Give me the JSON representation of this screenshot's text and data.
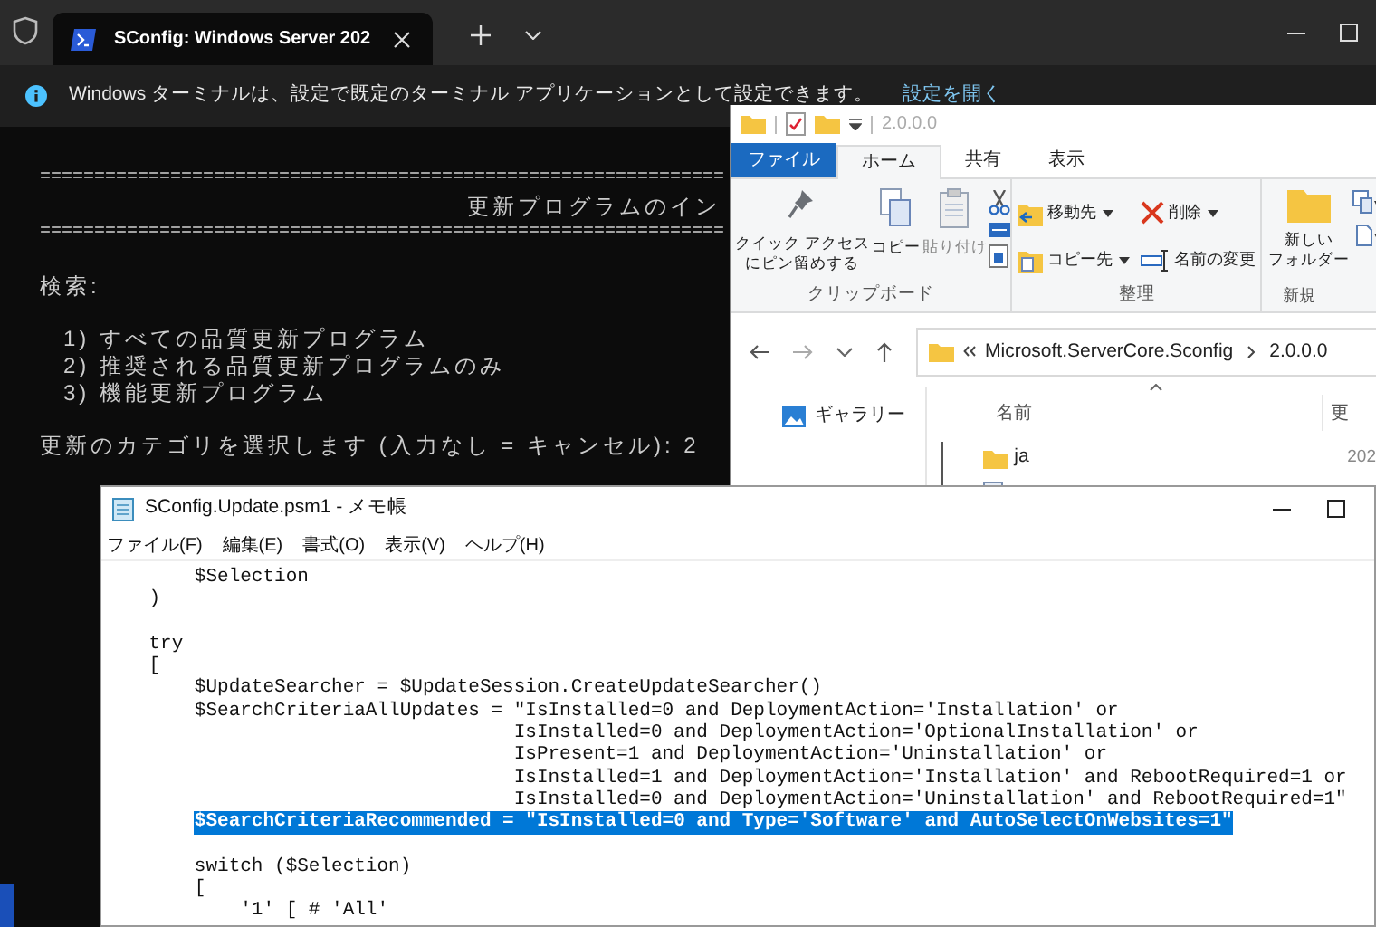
{
  "terminal": {
    "tabs": [
      {
        "title": "SConfig: Windows Server 202",
        "selected": true
      }
    ],
    "notification": {
      "text": "Windows ターミナルは、設定で既定のターミナル アプリケーションとして設定できます。",
      "link": "設定を開く"
    },
    "lines": [
      {
        "kind": "rule",
        "text": "==============================================================="
      },
      {
        "kind": "heading",
        "text": "更新プログラムのイン"
      },
      {
        "kind": "rule",
        "text": "==============================================================="
      },
      {
        "kind": "blank"
      },
      {
        "kind": "text",
        "text": "検索:"
      },
      {
        "kind": "blank"
      },
      {
        "kind": "item",
        "text": "1) すべての品質更新プログラム"
      },
      {
        "kind": "item",
        "text": "2) 推奨される品質更新プログラムのみ"
      },
      {
        "kind": "item",
        "text": "3) 機能更新プログラム"
      },
      {
        "kind": "blank"
      },
      {
        "kind": "text",
        "text": "更新のカテゴリを選択します (入力なし = キャンセル): 2"
      }
    ]
  },
  "explorer": {
    "title": "2.0.0.0",
    "ribbon_tabs": [
      {
        "label": "ファイル",
        "kind": "file",
        "selected": false
      },
      {
        "label": "ホーム",
        "kind": "tab",
        "selected": true
      },
      {
        "label": "共有",
        "kind": "tab",
        "selected": false
      },
      {
        "label": "表示",
        "kind": "tab",
        "selected": false
      }
    ],
    "clipboard": {
      "label": "クリップボード",
      "buttons": [
        {
          "lines": [
            "クイック アクセス",
            "にピン留めする"
          ],
          "kind": "pin",
          "disabled": false
        },
        {
          "lines": [
            "コピー"
          ],
          "kind": "copy",
          "disabled": false
        },
        {
          "lines": [
            "貼り付け"
          ],
          "kind": "paste",
          "disabled": true
        }
      ]
    },
    "organize": {
      "label": "整理",
      "buttons": [
        {
          "label": "移動先",
          "kind": "move",
          "menu": true
        },
        {
          "label": "コピー先",
          "kind": "copyto",
          "menu": true
        },
        {
          "label": "削除",
          "kind": "delete",
          "menu": true
        },
        {
          "label": "名前の変更",
          "kind": "rename",
          "menu": false
        }
      ]
    },
    "new": {
      "label": "新規",
      "button": [
        "新しい",
        "フォルダー"
      ]
    },
    "path": [
      "Microsoft.ServerCore.Sconfig",
      "2.0.0.0"
    ],
    "nav_items": [
      {
        "label": "ギャラリー"
      }
    ],
    "columns": [
      "名前",
      "更"
    ],
    "rows": [
      {
        "name": "ja",
        "column_2": "202"
      }
    ]
  },
  "notepad": {
    "title": "SConfig.Update.psm1 - メモ帳",
    "menu": [
      "ファイル(F)",
      "編集(E)",
      "書式(O)",
      "表示(V)",
      "ヘルプ(H)"
    ],
    "lines": [
      {
        "text": "        $Selection",
        "selected": false
      },
      {
        "text": "    )",
        "selected": false
      },
      {
        "selected": false
      },
      {
        "text": "    try",
        "selected": false
      },
      {
        "text": "    [",
        "selected": false
      },
      {
        "text": "        $UpdateSearcher = $UpdateSession.CreateUpdateSearcher()",
        "selected": false
      },
      {
        "text": "        $SearchCriteriaAllUpdates = \"IsInstalled=0 and DeploymentAction='Installation' or",
        "selected": false
      },
      {
        "text": "                                    IsInstalled=0 and DeploymentAction='OptionalInstallation' or",
        "selected": false
      },
      {
        "text": "                                    IsPresent=1 and DeploymentAction='Uninstallation' or",
        "selected": false
      },
      {
        "text": "                                    IsInstalled=1 and DeploymentAction='Installation' and RebootRequired=1 or",
        "selected": false
      },
      {
        "text": "                                    IsInstalled=0 and DeploymentAction='Uninstallation' and RebootRequired=1\"",
        "selected": false
      },
      {
        "text": "        $SearchCriteriaRecommended = \"IsInstalled=0 and Type='Software' and AutoSelectOnWebsites=1\"",
        "selected": true
      },
      {
        "selected": false
      },
      {
        "text": "        switch ($Selection)",
        "selected": false
      },
      {
        "text": "        [",
        "selected": false
      },
      {
        "text": "            '1' [ # 'All'",
        "selected": false
      }
    ]
  }
}
